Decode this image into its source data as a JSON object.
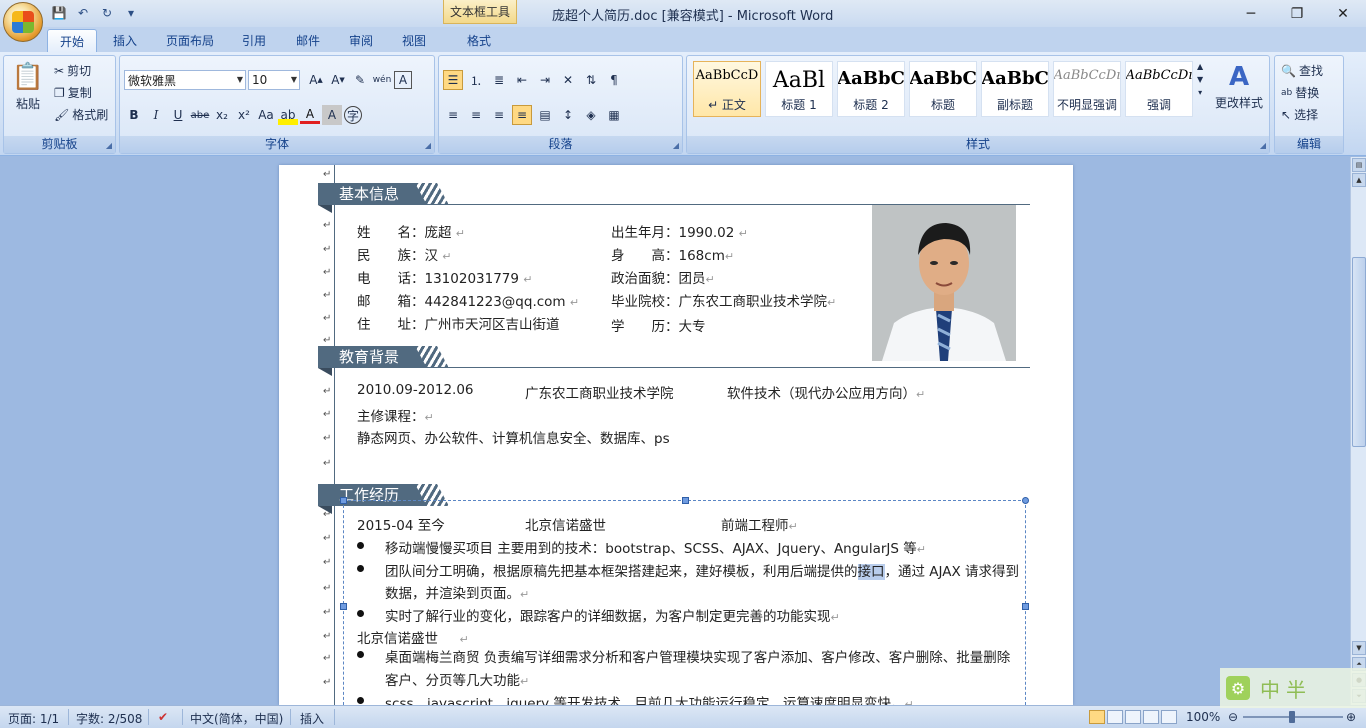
{
  "window": {
    "title": "庞超个人简历.doc [兼容模式] - Microsoft Word",
    "context_tab_title": "文本框工具",
    "minimize": "─",
    "maximize": "❐",
    "close": "✕"
  },
  "quick_access": {
    "save": "💾",
    "undo": "↶",
    "redo": "↻",
    "customize": "▾"
  },
  "tabs": [
    {
      "label": "开始",
      "active": true
    },
    {
      "label": "插入"
    },
    {
      "label": "页面布局"
    },
    {
      "label": "引用"
    },
    {
      "label": "邮件"
    },
    {
      "label": "审阅"
    },
    {
      "label": "视图"
    },
    {
      "label": "格式"
    }
  ],
  "ribbon": {
    "clipboard": {
      "label": "剪贴板",
      "paste": "粘贴",
      "cut": "剪切",
      "copy": "复制",
      "format_painter": "格式刷"
    },
    "font": {
      "label": "字体",
      "font_name": "微软雅黑",
      "font_size": "10"
    },
    "paragraph": {
      "label": "段落"
    },
    "styles": {
      "label": "样式",
      "items": [
        {
          "sample": "AaBbCcD",
          "name": "↵ 正文",
          "selected": true
        },
        {
          "sample": "AaBl",
          "name": "标题 1"
        },
        {
          "sample": "AaBbC",
          "name": "标题 2"
        },
        {
          "sample": "AaBbC",
          "name": "标题"
        },
        {
          "sample": "AaBbC",
          "name": "副标题"
        },
        {
          "sample": "AaBbCcDı",
          "name": "不明显强调"
        },
        {
          "sample": "AaBbCcDı",
          "name": "强调"
        }
      ],
      "change_styles": "更改样式"
    },
    "editing": {
      "label": "编辑",
      "find": "查找",
      "replace": "替换",
      "select": "选择"
    }
  },
  "document": {
    "sections": {
      "basic": "基本信息",
      "education": "教育背景",
      "work": "工作经历"
    },
    "basic_info": {
      "left": [
        {
          "label": "姓　　名",
          "value": "：庞超"
        },
        {
          "label": "民　　族",
          "value": "：汉"
        },
        {
          "label": "电　　话",
          "value": "：13102031779"
        },
        {
          "label": "邮　　箱",
          "value": "：442841223@qq.com"
        },
        {
          "label": "住　　址",
          "value": "：广州市天河区吉山街道"
        }
      ],
      "right": [
        {
          "label": "出生年月",
          "value": "：1990.02"
        },
        {
          "label": "身　　高",
          "value": "：168cm"
        },
        {
          "label": "政治面貌",
          "value": "：团员"
        },
        {
          "label": "毕业院校",
          "value": "：广东农工商职业技术学院"
        },
        {
          "label": "学　　历",
          "value": "：大专"
        }
      ]
    },
    "education": {
      "period": "2010.09-2012.06",
      "school": "广东农工商职业技术学院",
      "major": "软件技术（现代办公应用方向）",
      "courses_label": "主修课程：",
      "courses": "静态网页、办公软件、计算机信息安全、数据库、ps"
    },
    "work": {
      "period": "2015-04 至今",
      "company": "北京信诺盛世",
      "position": "前端工程师",
      "bullets": [
        "移动端慢慢买项目  主要用到的技术：bootstrap、SCSS、AJAX、Jquery、AngularJS 等",
        "团队间分工明确，根据原稿先把基本框架搭建起来，建好模板，利用后端提供的",
        "数据，并渲染到页面。",
        "实时了解行业的变化，跟踪客户的详细数据，为客户制定更完善的功能实现"
      ],
      "highlight": "接口",
      "bullet2_tail": "，通过 AJAX 请求得到",
      "company2": "北京信诺盛世",
      "bullets2": [
        "桌面端梅兰商贸   负责编写详细需求分析和客户管理模块实现了客户添加、客户修改、客户删除、批量删除",
        "客户、分页等几大功能",
        "scss、javascript、jquery 等开发技术，目前几大功能运行稳定，运算速度明显变快。"
      ]
    }
  },
  "statusbar": {
    "page": "页面: 1/1",
    "words": "字数: 2/508",
    "language": "中文(简体，中国)",
    "mode": "插入",
    "zoom": "100%",
    "zoom_minus": "⊖",
    "zoom_plus": "⊕"
  },
  "watermark": {
    "text": "中半",
    "icon": "gear-icon"
  },
  "colors": {
    "section_bar": "#516a80",
    "ribbon_bg": "#dfe9f7",
    "workspace": "#9db9e1"
  }
}
